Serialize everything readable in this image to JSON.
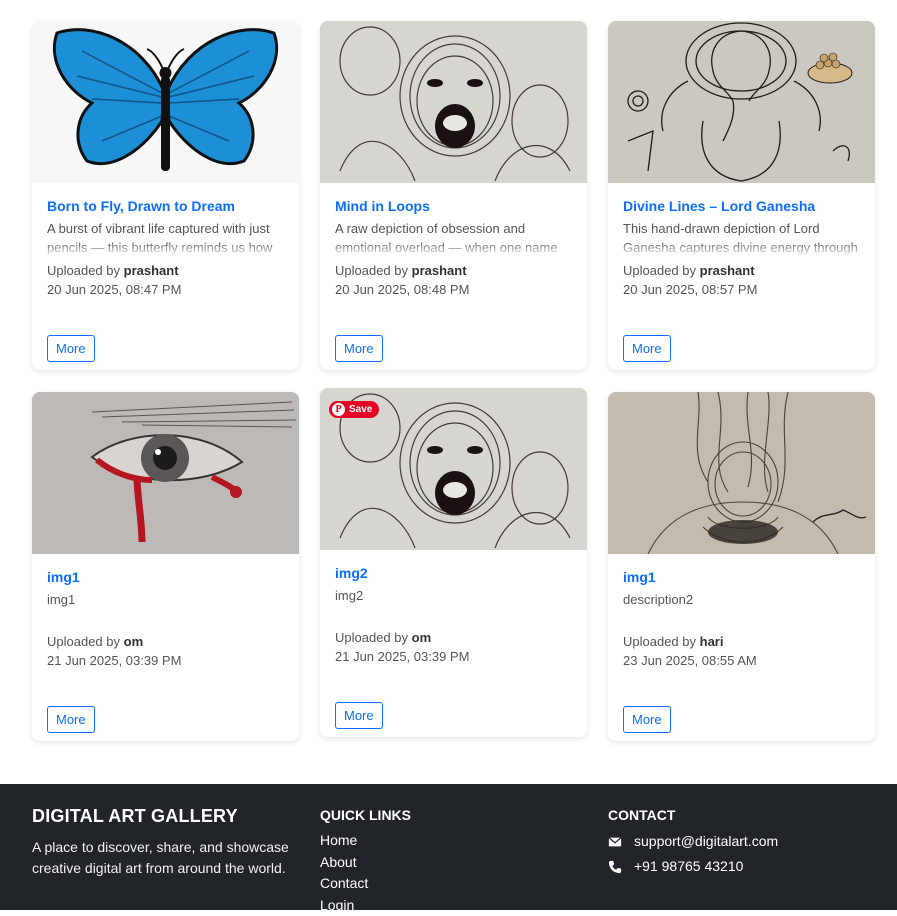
{
  "cards": [
    {
      "title": "Born to Fly, Drawn to Dream",
      "description": "A burst of vibrant life captured with just pencils — this butterfly reminds us how",
      "uploaded_by_label": "Uploaded by",
      "user": "prashant",
      "date": "20 Jun 2025, 08:47 PM",
      "more_label": "More",
      "image": "blue-butterfly-drawing"
    },
    {
      "title": "Mind in Loops",
      "description": "A raw depiction of obsession and emotional overload — when one name",
      "uploaded_by_label": "Uploaded by",
      "user": "prashant",
      "date": "20 Jun 2025, 08:48 PM",
      "more_label": "More",
      "image": "scribble-screaming-face"
    },
    {
      "title": "Divine Lines – Lord Ganesha",
      "description": "This hand-drawn depiction of Lord Ganesha captures divine energy through",
      "uploaded_by_label": "Uploaded by",
      "user": "prashant",
      "date": "20 Jun 2025, 08:57 PM",
      "more_label": "More",
      "image": "ganesha-sketch"
    },
    {
      "title": "img1",
      "description": "img1",
      "uploaded_by_label": "Uploaded by",
      "user": "om",
      "date": "21 Jun 2025, 03:39 PM",
      "more_label": "More",
      "image": "crying-eye-drawing"
    },
    {
      "title": "img2",
      "description": "img2",
      "uploaded_by_label": "Uploaded by",
      "user": "om",
      "date": "21 Jun 2025, 03:39 PM",
      "more_label": "More",
      "image": "scribble-screaming-face",
      "save_badge": "Save"
    },
    {
      "title": "img1",
      "description": "description2",
      "uploaded_by_label": "Uploaded by",
      "user": "hari",
      "date": "23 Jun 2025, 08:55 AM",
      "more_label": "More",
      "image": "scribble-portrait"
    }
  ],
  "footer": {
    "brand": "DIGITAL ART GALLERY",
    "tagline": "A place to discover, share, and showcase creative digital art from around the world.",
    "quick_links_heading": "QUICK LINKS",
    "quick_links": [
      "Home",
      "About",
      "Contact",
      "Login"
    ],
    "contact_heading": "CONTACT",
    "email": "support@digitalart.com",
    "phone": "+91 98765 43210",
    "icons": {
      "email": "envelope-icon",
      "phone": "phone-icon"
    }
  },
  "colors": {
    "accent": "#0d6efd",
    "footer_bg": "#212529",
    "pinterest": "#e60023"
  }
}
